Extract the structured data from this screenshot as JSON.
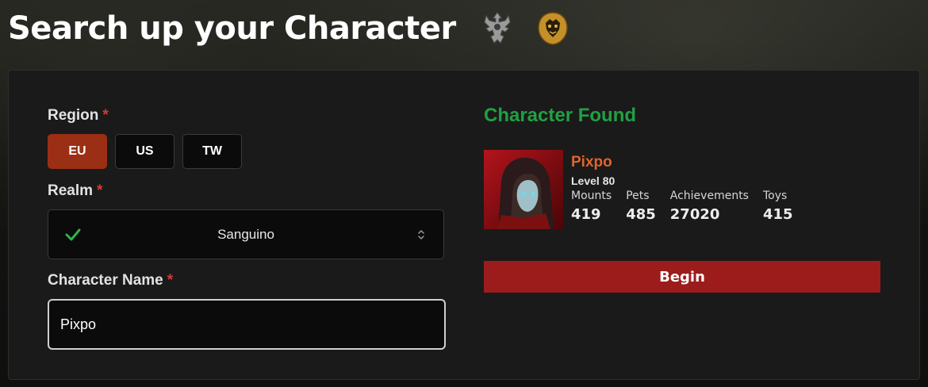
{
  "header": {
    "title": "Search up your Character",
    "faction_icons": [
      "horde-icon",
      "alliance-icon"
    ]
  },
  "form": {
    "region": {
      "label": "Region",
      "required_marker": "*",
      "options": [
        "EU",
        "US",
        "TW"
      ],
      "selected": "EU"
    },
    "realm": {
      "label": "Realm",
      "required_marker": "*",
      "value": "Sanguino",
      "status_icon": "checkmark-icon",
      "control_icon": "chevron-up-down-icon"
    },
    "character_name": {
      "label": "Character Name",
      "required_marker": "*",
      "value": "Pixpo"
    }
  },
  "result": {
    "title": "Character Found",
    "character": {
      "name": "Pixpo",
      "level": "Level 80",
      "stats": [
        {
          "label": "Mounts",
          "value": "419"
        },
        {
          "label": "Pets",
          "value": "485"
        },
        {
          "label": "Achievements",
          "value": "27020"
        },
        {
          "label": "Toys",
          "value": "415"
        }
      ]
    },
    "begin_label": "Begin"
  },
  "colors": {
    "accent_region": "#9b2f15",
    "found_green": "#21a043",
    "name_orange": "#e0652a",
    "begin_red": "#9c1c1c",
    "required_red": "#d63a2f"
  }
}
